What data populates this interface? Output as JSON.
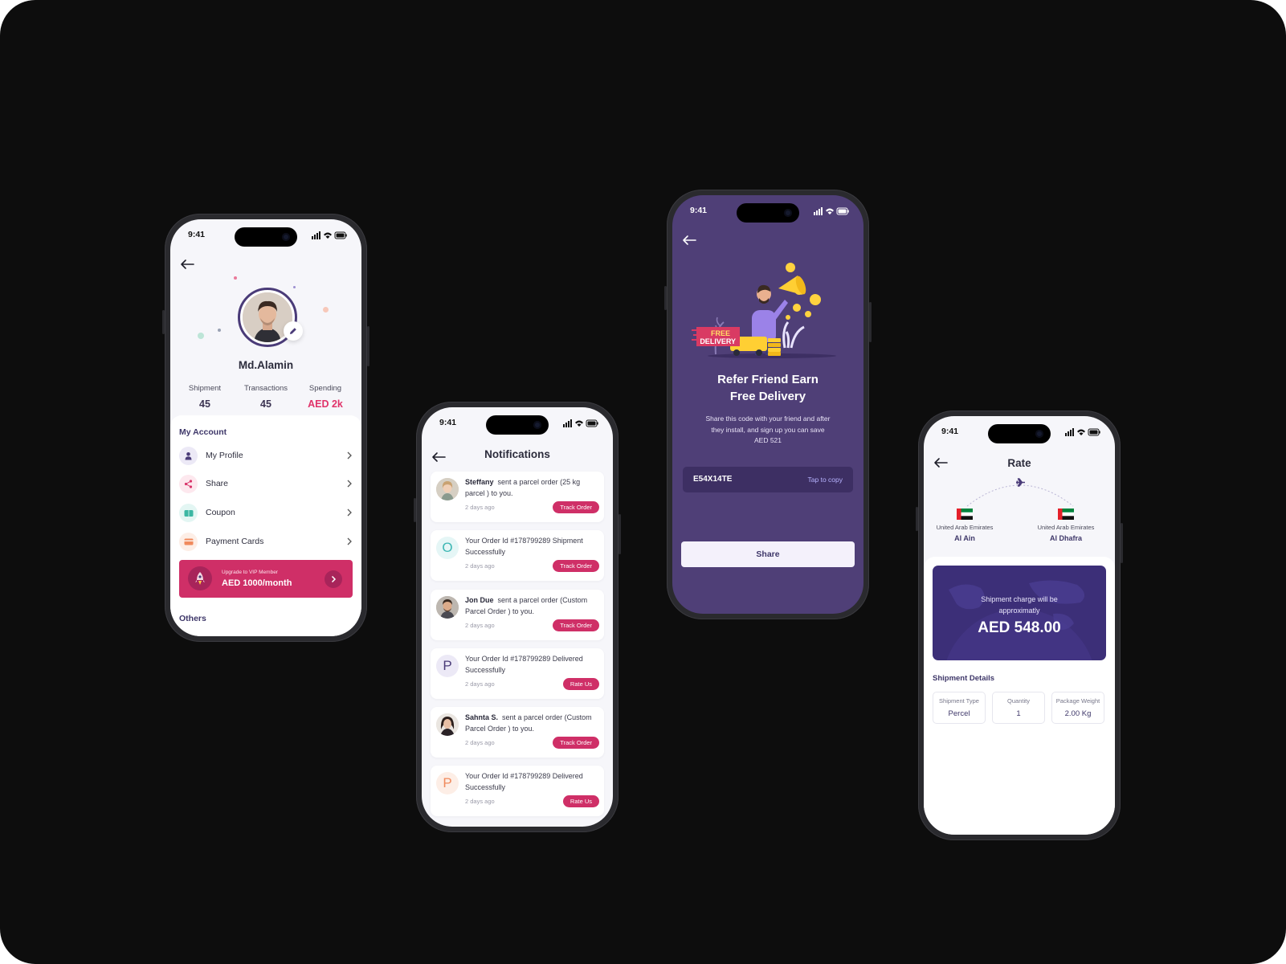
{
  "status_time": "9:41",
  "profile": {
    "name": "Md.Alamin",
    "stats": [
      {
        "label": "Shipment",
        "value": "45"
      },
      {
        "label": "Transactions",
        "value": "45"
      },
      {
        "label": "Spending",
        "value": "AED 2k"
      }
    ],
    "section_title": "My Account",
    "menu": [
      {
        "label": "My Profile",
        "icon": "user-icon"
      },
      {
        "label": "Share",
        "icon": "share-icon"
      },
      {
        "label": "Coupon",
        "icon": "coupon-icon"
      },
      {
        "label": "Payment Cards",
        "icon": "card-icon"
      }
    ],
    "vip": {
      "caption": "Upgrade to VIP Member",
      "price": "AED 1000/month"
    },
    "others_title": "Others"
  },
  "notifications": {
    "title": "Notifications",
    "items": [
      {
        "name": "Steffany",
        "text": "sent a parcel order (25 kg parcel ) to you.",
        "time": "2 days ago",
        "action": "Track Order"
      },
      {
        "name": "",
        "text": "Your Order Id #178799289 Shipment Successfully",
        "time": "2 days ago",
        "action": "Track Order",
        "letter": "O"
      },
      {
        "name": "Jon Due",
        "text": "sent a parcel order (Custom Parcel Order ) to you.",
        "time": "2 days ago",
        "action": "Track Order"
      },
      {
        "name": "",
        "text": "Your Order Id #178799289 Delivered Successfully",
        "time": "2 days ago",
        "action": "Rate Us",
        "letter": "P"
      },
      {
        "name": "Sahnta S.",
        "text": "sent a parcel order (Custom Parcel Order ) to you.",
        "time": "2 days ago",
        "action": "Track Order"
      },
      {
        "name": "",
        "text": "Your Order Id #178799289 Delivered Successfully",
        "time": "2 days ago",
        "action": "Rate Us",
        "letter": "P"
      }
    ]
  },
  "refer": {
    "badge_line1": "FREE",
    "badge_line2": "DELIVERY",
    "title_line1": "Refer Friend Earn",
    "title_line2": "Free Delivery",
    "description": "Share this code with your friend and after they install, and sign up you can save AED 521",
    "code": "E54X14TE",
    "copy_label": "Tap to copy",
    "share_label": "Share"
  },
  "rate": {
    "title": "Rate",
    "from": {
      "country": "United Arab Emirates",
      "city": "Al Ain"
    },
    "to": {
      "country": "United Arab Emirates",
      "city": "Al Dhafra"
    },
    "charge_caption_1": "Shipment charge will be",
    "charge_caption_2": "approximatly",
    "charge_amount": "AED 548.00",
    "details_title": "Shipment Details",
    "details": [
      {
        "label": "Shipment Type",
        "value": "Percel"
      },
      {
        "label": "Quantity",
        "value": "1"
      },
      {
        "label": "Package Weight",
        "value": "2.00 Kg"
      }
    ]
  }
}
